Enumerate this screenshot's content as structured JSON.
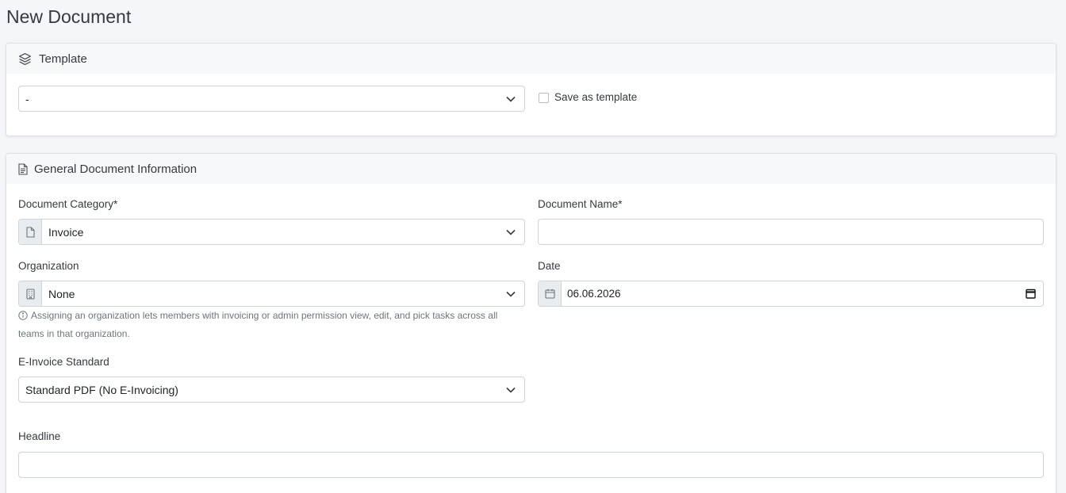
{
  "page": {
    "title": "New Document"
  },
  "template_card": {
    "title": "Template",
    "icon": "layers-icon",
    "select_value": "-",
    "save_as_template_label": "Save as template",
    "save_as_template_checked": false
  },
  "general_card": {
    "title": "General Document Information",
    "icon": "document-icon",
    "category": {
      "label": "Document Category*",
      "value": "Invoice",
      "icon": "file-icon"
    },
    "name": {
      "label": "Document Name*",
      "value": ""
    },
    "organization": {
      "label": "Organization",
      "value": "None",
      "icon": "building-icon",
      "help": "Assigning an organization lets members with invoicing or admin permission view, edit, and pick tasks across all teams in that organization."
    },
    "date": {
      "label": "Date",
      "value": "06.06.2026",
      "icon": "calendar-icon"
    },
    "einvoice": {
      "label": "E-Invoice Standard",
      "value": "Standard PDF (No E-Invoicing)"
    },
    "headline": {
      "label": "Headline",
      "value": ""
    }
  }
}
